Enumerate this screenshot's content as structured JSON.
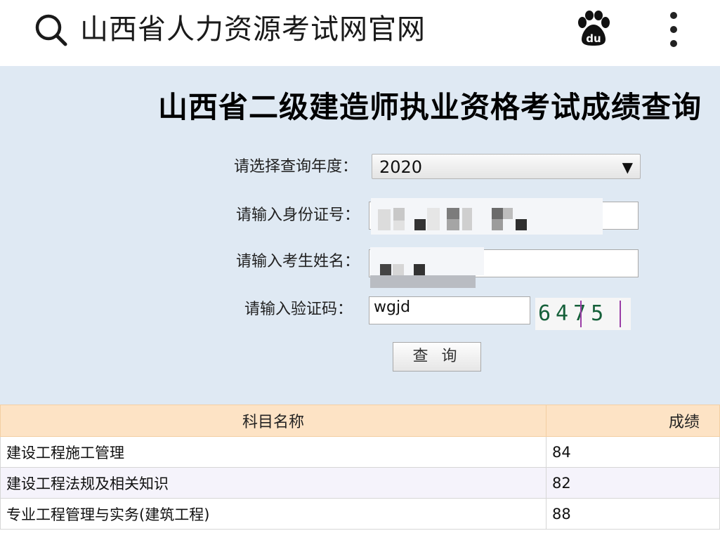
{
  "browser": {
    "title": "山西省人力资源考试网官网",
    "icons": {
      "search": "search-icon",
      "app": "baidu-paw-icon",
      "menu": "more-vert-icon"
    }
  },
  "page": {
    "title": "山西省二级建造师执业资格考试成绩查询"
  },
  "form": {
    "year_label": "请选择查询年度：",
    "year_value": "2020",
    "year_arrow": "▼",
    "id_label": "请输入身份证号：",
    "name_label": "请输入考生姓名：",
    "captcha_label": "请输入验证码：",
    "captcha_input": "wgjd",
    "captcha_image_text": "6475",
    "submit_label": "查 询"
  },
  "results": {
    "headers": [
      "科目名称",
      "成绩"
    ],
    "rows": [
      {
        "subject": "建设工程施工管理",
        "score": "84"
      },
      {
        "subject": "建设工程法规及相关知识",
        "score": "82"
      },
      {
        "subject": "专业工程管理与实务(建筑工程)",
        "score": "88"
      }
    ]
  },
  "colors": {
    "panel_bg": "#dfe9f3",
    "table_header_bg": "#fde3c5",
    "alt_row_bg": "#f5f3fb",
    "captcha_digits": "#15603a",
    "captcha_lines": "#9a3da6"
  }
}
